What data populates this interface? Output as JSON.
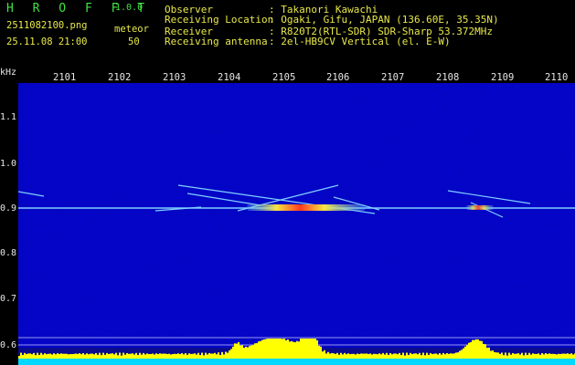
{
  "header": {
    "app_name": "H R O F F T",
    "version": "1.0.0",
    "filename": "2511082100.png",
    "datetime": "25.11.08 21:00",
    "count_label": "meteor",
    "count_value": "50",
    "info": [
      {
        "key": "Observer",
        "value": ": Takanori Kawachi"
      },
      {
        "key": "Receiving Location",
        "value": ": Ogaki, Gifu, JAPAN (136.60E, 35.35N)"
      },
      {
        "key": "Receiver",
        "value": ": R820T2(RTL-SDR) SDR-Sharp 53.372MHz"
      },
      {
        "key": "Receiving antenna",
        "value": ": 2el-HB9CV Vertical (el. E-W)"
      }
    ]
  },
  "axes": {
    "y_unit": "kHz",
    "y_ticks": [
      "1.1",
      "1.0",
      "0.9",
      "0.8",
      "0.7",
      "0.6"
    ],
    "x_ticks": [
      "2101",
      "2102",
      "2103",
      "2104",
      "2105",
      "2106",
      "2107",
      "2108",
      "2109",
      "2110"
    ]
  },
  "colors": {
    "background": "#000000",
    "header_green": "#42e142",
    "header_yellow": "#e8e84a",
    "spectrogram_base": "#0a0c8c",
    "carrier_line": "#7fd0ff",
    "meteor_hot": "#ff3b1f",
    "meteor_warm": "#f7e640",
    "activity_bar": "#ffff00",
    "baseline": "#00d8ff"
  }
}
